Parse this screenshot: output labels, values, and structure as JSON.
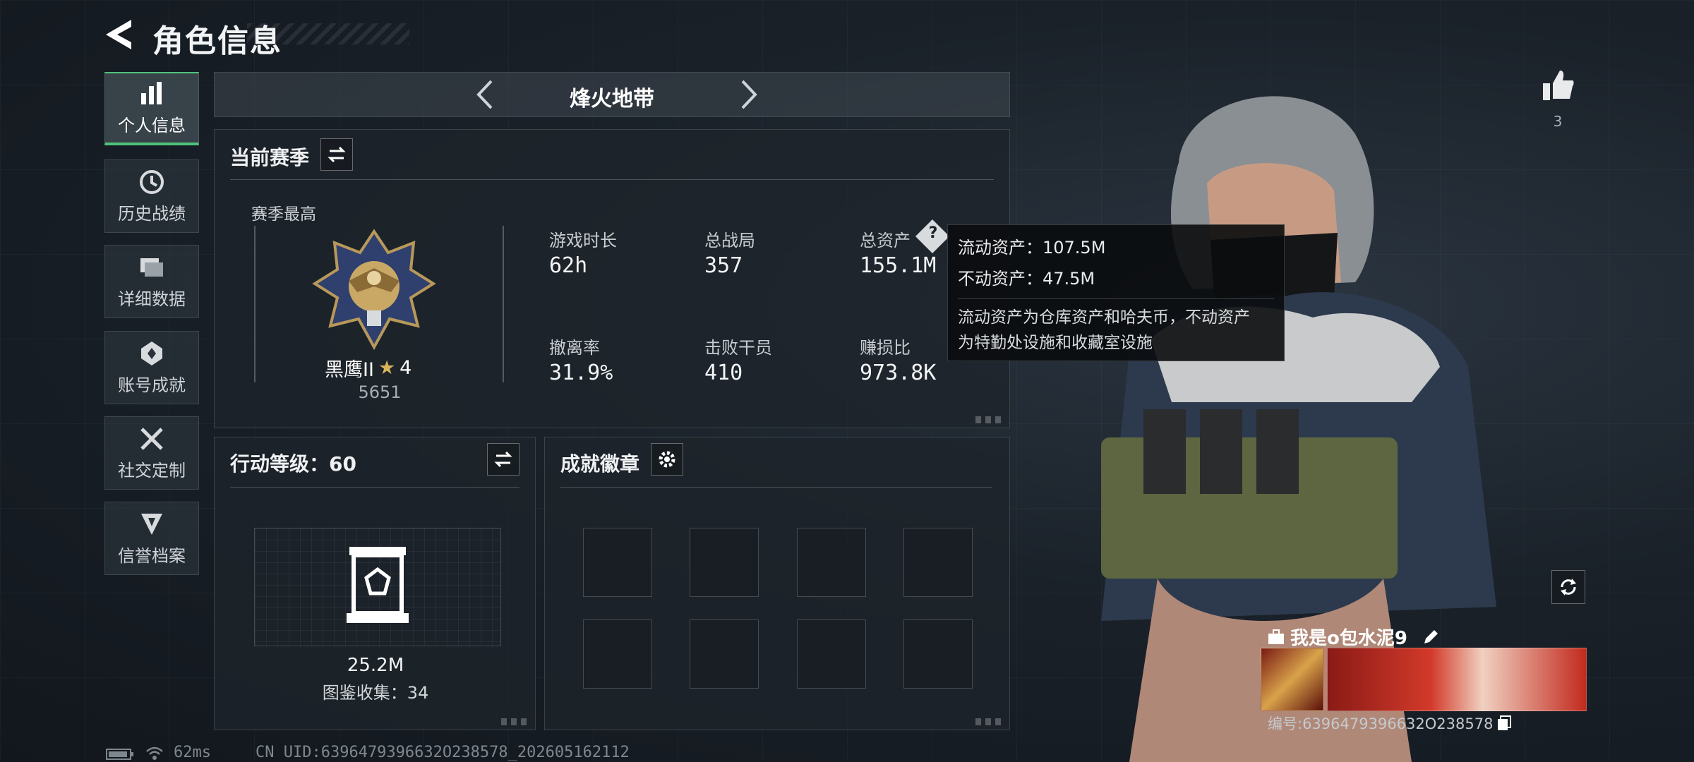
{
  "header": {
    "title": "角色信息"
  },
  "sidebar": {
    "items": [
      {
        "label": "个人信息",
        "icon": "bar-chart-icon",
        "active": true
      },
      {
        "label": "历史战绩",
        "icon": "history-icon"
      },
      {
        "label": "详细数据",
        "icon": "folder-icon"
      },
      {
        "label": "账号成就",
        "icon": "achievement-icon"
      },
      {
        "label": "社交定制",
        "icon": "tools-icon"
      },
      {
        "label": "信誉档案",
        "icon": "credit-icon"
      }
    ]
  },
  "mode": {
    "name": "烽火地带"
  },
  "season": {
    "title": "当前赛季",
    "best_label": "赛季最高",
    "rank_name": "黑鹰II",
    "rank_stars": "4",
    "rank_score": "5651",
    "stats": [
      {
        "label": "游戏时长",
        "value": "62h"
      },
      {
        "label": "总战局",
        "value": "357"
      },
      {
        "label": "总资产",
        "value": "155.1M"
      },
      {
        "label": "撤离率",
        "value": "31.9%"
      },
      {
        "label": "击败干员",
        "value": "410"
      },
      {
        "label": "赚损比",
        "value": "973.8K"
      }
    ]
  },
  "tooltip": {
    "liquid": "流动资产：107.5M",
    "fixed": "不动资产：47.5M",
    "desc_line1": "流动资产为仓库资产和哈夫币，不动资产",
    "desc_line2": "为特勤处设施和收藏室设施"
  },
  "action_level": {
    "title": "行动等级：60",
    "value": "25.2M",
    "collection": "图鉴收集：34"
  },
  "achievements": {
    "title": "成就徽章",
    "slots": 8
  },
  "profile": {
    "likes": "3",
    "player_name": "我是o包水泥9",
    "player_id": "编号:6396479396632O238578"
  },
  "footer": {
    "ping": "62ms",
    "uid": "CN UID:6396479396632O238578_202605162112"
  },
  "colors": {
    "accent_green": "#4fc27a",
    "tooltip_bg": "#0a0c0e"
  }
}
